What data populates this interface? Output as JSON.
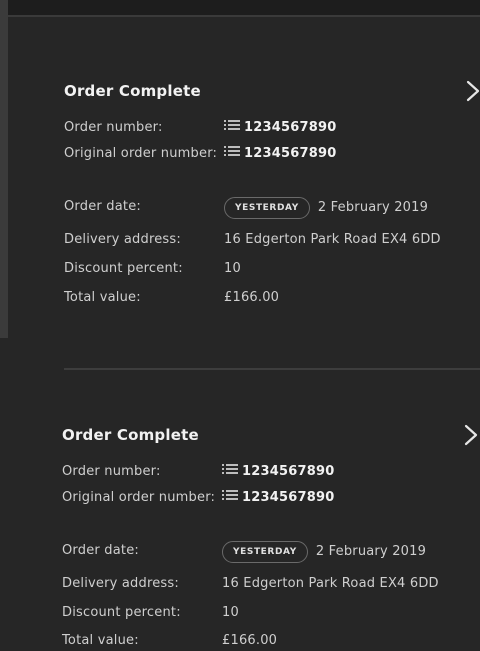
{
  "orders": [
    {
      "title": "Order Complete",
      "order_number_label": "Order number:",
      "order_number": "1234567890",
      "original_order_number_label": "Original order number:",
      "original_order_number": "1234567890",
      "order_date_label": "Order date:",
      "order_date_badge": "YESTERDAY",
      "order_date": "2 February 2019",
      "delivery_address_label": "Delivery address:",
      "delivery_address": "16 Edgerton Park Road EX4 6DD",
      "discount_percent_label": "Discount percent:",
      "discount_percent": "10",
      "total_value_label": "Total value:",
      "total_value": "£166.00"
    },
    {
      "title": "Order Complete",
      "order_number_label": "Order number:",
      "order_number": "1234567890",
      "original_order_number_label": "Original order number:",
      "original_order_number": "1234567890",
      "order_date_label": "Order date:",
      "order_date_badge": "YESTERDAY",
      "order_date": "2 February 2019",
      "delivery_address_label": "Delivery address:",
      "delivery_address": "16 Edgerton Park Road EX4 6DD",
      "discount_percent_label": "Discount percent:",
      "discount_percent": "10",
      "total_value_label": "Total value:",
      "total_value": "£166.00"
    }
  ],
  "icons": {
    "chevron": "chevron-right-icon",
    "list": "list-icon"
  },
  "colors": {
    "background": "#262626",
    "text": "#cfcfcf",
    "title": "#f2f2f2",
    "divider": "#3d3d3d"
  }
}
